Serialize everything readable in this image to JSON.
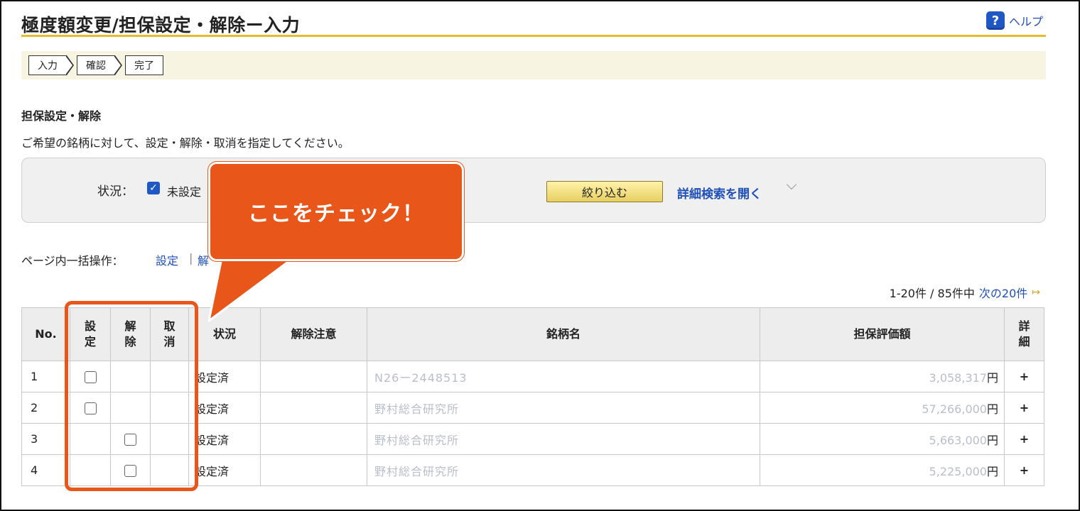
{
  "header": {
    "title": "極度額変更/担保設定・解除ー入力",
    "help_label": "ヘルプ",
    "help_icon_glyph": "?"
  },
  "steps": [
    "入力",
    "確認",
    "完了"
  ],
  "section": {
    "heading": "担保設定・解除",
    "instruction": "ご希望の銘柄に対して、設定・解除・取消を指定してください。"
  },
  "filter": {
    "status_label": "状況：",
    "status_option": "未設定",
    "status_checked": true,
    "filter_button": "絞り込む",
    "detail_link": "詳細検索を開く"
  },
  "bulk": {
    "label": "ページ内一括操作：",
    "set": "設定",
    "separator": "|",
    "release_partial": "解"
  },
  "pager": {
    "summary": "1-20件 / 85件中",
    "next": "次の20件",
    "next_icon": "arrow-right-icon"
  },
  "table": {
    "headers": {
      "no": "No.",
      "set": "設定",
      "release": "解除",
      "cancel": "取消",
      "status": "状況",
      "release_note": "解除注意",
      "name": "銘柄名",
      "value": "担保評価額",
      "detail": "詳細"
    },
    "rows": [
      {
        "no": "1",
        "set_checkbox": true,
        "release_checkbox": false,
        "status": "設定済",
        "name": "N26ー2448513",
        "value": "3,058,317",
        "yen": "円",
        "detail": "+"
      },
      {
        "no": "2",
        "set_checkbox": true,
        "release_checkbox": false,
        "status": "設定済",
        "name": "野村総合研究所",
        "value": "57,266,000",
        "yen": "円",
        "detail": "+"
      },
      {
        "no": "3",
        "set_checkbox": false,
        "release_checkbox": true,
        "status": "設定済",
        "name": "野村総合研究所",
        "value": "5,663,000",
        "yen": "円",
        "detail": "+"
      },
      {
        "no": "4",
        "set_checkbox": false,
        "release_checkbox": true,
        "status": "設定済",
        "name": "野村総合研究所",
        "value": "5,225,000",
        "yen": "円",
        "detail": "+"
      }
    ]
  },
  "callout": {
    "text": "ここをチェック！",
    "color": "#e8561a"
  }
}
